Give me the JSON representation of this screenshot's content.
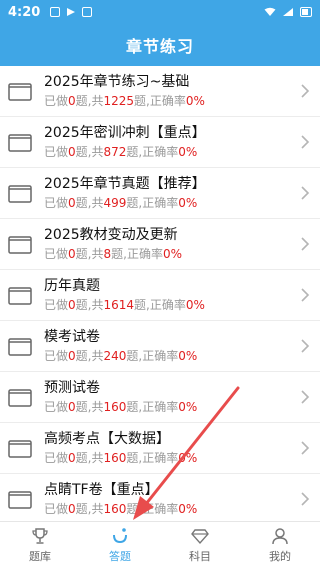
{
  "status_bar": {
    "time": "4:20"
  },
  "header": {
    "title": "章节练习"
  },
  "list": [
    {
      "title": "2025年章节练习~基础",
      "done_prefix": "已做",
      "done": "0",
      "total_prefix": "题,共",
      "total": "1225",
      "rate_prefix": "题,正确率",
      "rate": "0%"
    },
    {
      "title": "2025年密训冲刺【重点】",
      "done_prefix": "已做",
      "done": "0",
      "total_prefix": "题,共",
      "total": "872",
      "rate_prefix": "题,正确率",
      "rate": "0%"
    },
    {
      "title": "2025年章节真题【推荐】",
      "done_prefix": "已做",
      "done": "0",
      "total_prefix": "题,共",
      "total": "499",
      "rate_prefix": "题,正确率",
      "rate": "0%"
    },
    {
      "title": "2025教材变动及更新",
      "done_prefix": "已做",
      "done": "0",
      "total_prefix": "题,共",
      "total": "8",
      "rate_prefix": "题,正确率",
      "rate": "0%"
    },
    {
      "title": "历年真题",
      "done_prefix": "已做",
      "done": "0",
      "total_prefix": "题,共",
      "total": "1614",
      "rate_prefix": "题,正确率",
      "rate": "0%"
    },
    {
      "title": "模考试卷",
      "done_prefix": "已做",
      "done": "0",
      "total_prefix": "题,共",
      "total": "240",
      "rate_prefix": "题,正确率",
      "rate": "0%"
    },
    {
      "title": "预测试卷",
      "done_prefix": "已做",
      "done": "0",
      "total_prefix": "题,共",
      "total": "160",
      "rate_prefix": "题,正确率",
      "rate": "0%"
    },
    {
      "title": "高频考点【大数据】",
      "done_prefix": "已做",
      "done": "0",
      "total_prefix": "题,共",
      "total": "160",
      "rate_prefix": "题,正确率",
      "rate": "0%"
    },
    {
      "title": "点睛TF卷【重点】",
      "done_prefix": "已做",
      "done": "0",
      "total_prefix": "题,共",
      "total": "160",
      "rate_prefix": "题,正确率",
      "rate": "0%"
    }
  ],
  "tabs": [
    {
      "label": "题库",
      "icon": "trophy-icon"
    },
    {
      "label": "答题",
      "icon": "answer-icon",
      "active": true
    },
    {
      "label": "科目",
      "icon": "diamond-icon"
    },
    {
      "label": "我的",
      "icon": "user-icon"
    }
  ],
  "colors": {
    "accent": "#3fa6e6",
    "highlight": "#e02020",
    "annotation": "#e84c4c"
  }
}
